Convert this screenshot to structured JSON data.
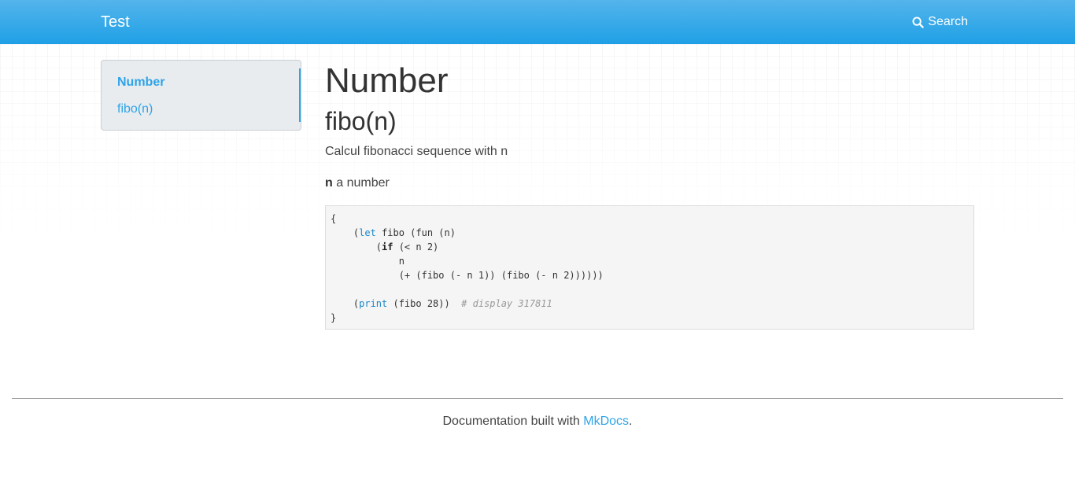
{
  "navbar": {
    "brand": "Test",
    "search_label": "Search",
    "search_icon": "search-icon"
  },
  "sidebar": {
    "items": [
      {
        "label": "Number",
        "active": true
      },
      {
        "label": "fibo(n)",
        "active": false
      }
    ],
    "accent": "#2fa4e7"
  },
  "content": {
    "title": "Number",
    "subtitle": "fibo(n)",
    "description": "Calcul fibonacci sequence with n",
    "param_name": "n",
    "param_desc": " a number",
    "code": {
      "line1": "{",
      "line2_open": "    (",
      "line2_kw": "let",
      "line2_rest": " fibo (fun (n)",
      "line3_open": "        (",
      "line3_kw": "if",
      "line3_rest": " (< n 2)",
      "line4": "            n",
      "line5": "            (+ (fibo (- n 1)) (fibo (- n 2))))))",
      "line6": "",
      "line7_open": "    (",
      "line7_kw": "print",
      "line7_rest": " (fibo 28))  ",
      "line7_comment": "# display 317811",
      "line8": "}"
    }
  },
  "footer": {
    "text_prefix": "Documentation built with ",
    "link_label": "MkDocs",
    "text_suffix": "."
  },
  "colors": {
    "navbar_top": "#54b4eb",
    "navbar_bottom": "#1fa0e6",
    "link": "#2fa4e7"
  }
}
